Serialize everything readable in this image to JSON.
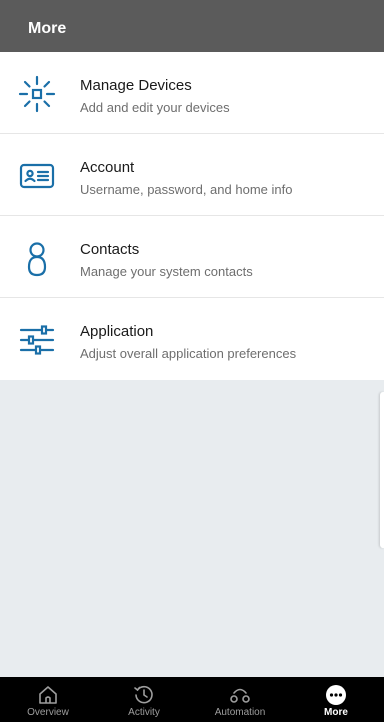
{
  "header": {
    "title": "More"
  },
  "menu": [
    {
      "title": "Manage Devices",
      "subtitle": "Add and edit your devices",
      "icon": "devices-icon"
    },
    {
      "title": "Account",
      "subtitle": "Username, password, and home info",
      "icon": "account-card-icon"
    },
    {
      "title": "Contacts",
      "subtitle": "Manage your system contacts",
      "icon": "contact-person-icon"
    },
    {
      "title": "Application",
      "subtitle": "Adjust overall application preferences",
      "icon": "sliders-icon"
    }
  ],
  "bottom_nav": [
    {
      "label": "Overview",
      "icon": "home-icon",
      "active": false
    },
    {
      "label": "Activity",
      "icon": "clock-icon",
      "active": false
    },
    {
      "label": "Automation",
      "icon": "automation-icon",
      "active": false
    },
    {
      "label": "More",
      "icon": "more-dots-icon",
      "active": true
    }
  ],
  "colors": {
    "header_bg": "#5b5b5b",
    "accent": "#1a6fa8",
    "content_bg": "#e8ecef",
    "nav_bg": "#000000",
    "nav_inactive": "#9e9e9e",
    "nav_active": "#ffffff"
  }
}
